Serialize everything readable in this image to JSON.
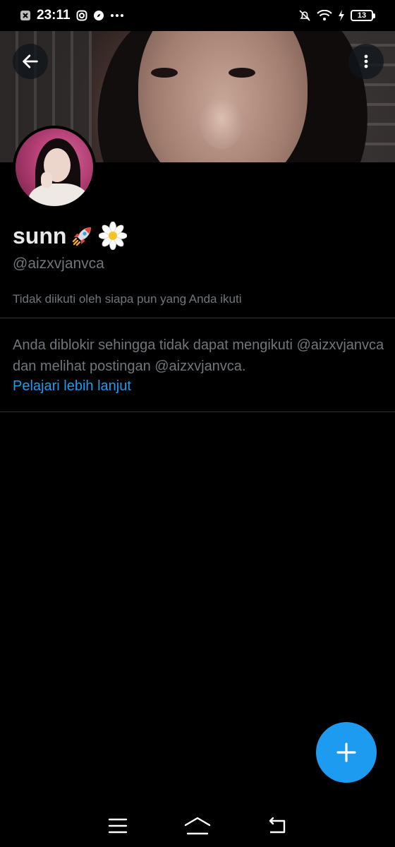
{
  "status_bar": {
    "time": "23:11",
    "battery": "13"
  },
  "profile": {
    "display_name": "sunn",
    "handle": "@aizxvjanvca",
    "followers_note": "Tidak diikuti oleh siapa pun yang Anda ikuti",
    "blocked_message": "Anda diblokir sehingga tidak dapat mengikuti @aizxvjanvca dan melihat postingan @aizxvjanvca.",
    "learn_more": "Pelajari lebih lanjut"
  },
  "icons": {
    "back": "arrow-left-icon",
    "more": "more-vertical-icon",
    "compose": "plus-icon",
    "name_emojis": [
      "rocket-icon",
      "daisy-icon"
    ]
  },
  "colors": {
    "accent": "#1d9bf0",
    "background": "#000000",
    "secondary_text": "#71767b",
    "primary_text": "#e7e9ea"
  }
}
